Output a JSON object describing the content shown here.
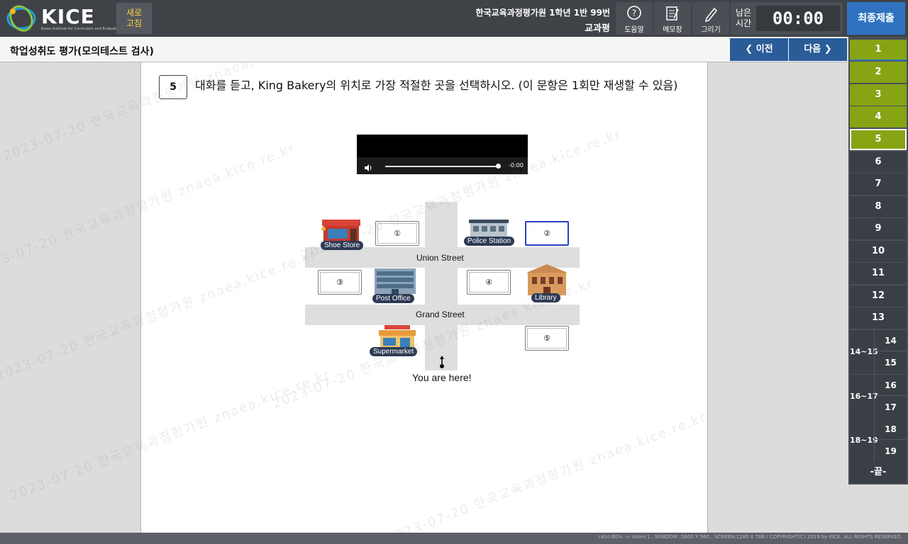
{
  "header": {
    "brand": "KICE",
    "brand_sub": "Korea Institute for Curriculum and Evaluation",
    "refresh_line1": "새로",
    "refresh_line2": "고침",
    "candidate_line1": "한국교육과정평가원 1학년 1반 99번",
    "candidate_line2": "교과평",
    "tools": {
      "help": "도움말",
      "memo": "메모장",
      "draw": "그리기"
    },
    "timer_label_1": "남은",
    "timer_label_2": "시간",
    "timer_value": "00:00",
    "submit": "최종제출"
  },
  "titlebar": {
    "title": "학업성취도 평가(모의테스트 검사)",
    "prev": "이전",
    "next": "다음"
  },
  "question": {
    "number": "5",
    "text": "대화를 듣고, King Bakery의 위치로 가장 적절한 곳을 선택하시오. (이 문항은 1회만 재생할 수 있음)",
    "audio_time": "-0:00"
  },
  "map": {
    "streets": [
      "Union Street",
      "Grand Street"
    ],
    "buildings": {
      "shoe": "Shoe Store",
      "police": "Police Station",
      "post": "Post Office",
      "library": "Library",
      "supermarket": "Supermarket"
    },
    "choices": [
      "①",
      "②",
      "③",
      "④",
      "⑤"
    ],
    "selected_choice": "②",
    "you_are_here": "You are here!"
  },
  "panel": {
    "items": [
      "1",
      "2",
      "3",
      "4",
      "5",
      "6",
      "7",
      "8",
      "9",
      "10",
      "11",
      "12",
      "13"
    ],
    "done": [
      "1",
      "2",
      "3",
      "4",
      "5"
    ],
    "current": "5",
    "groups": [
      {
        "label": "14~15",
        "a": "14",
        "b": "15"
      },
      {
        "label": "16~17",
        "a": "16",
        "b": "17"
      },
      {
        "label": "18~19",
        "a": "18",
        "b": "19"
      }
    ],
    "end": "-끝-"
  },
  "watermark": "2023-07-20 한국교육과정평가원 znaea.kice.re.kr",
  "footer": "ratio:80% -> zoom:1 , WINDOW :1600 X 960 , SCREEN:1280 X 768 / COPYRIGHT(C) 2019 by KICE. ALL RIGHTS RESERVED.",
  "colors": {
    "header_bg": "#3f4247",
    "submit_blue": "#2f73c0",
    "nav_blue": "#2a5c98",
    "done_green": "#86a414",
    "selected_choice_border": "#2b3fc4"
  }
}
